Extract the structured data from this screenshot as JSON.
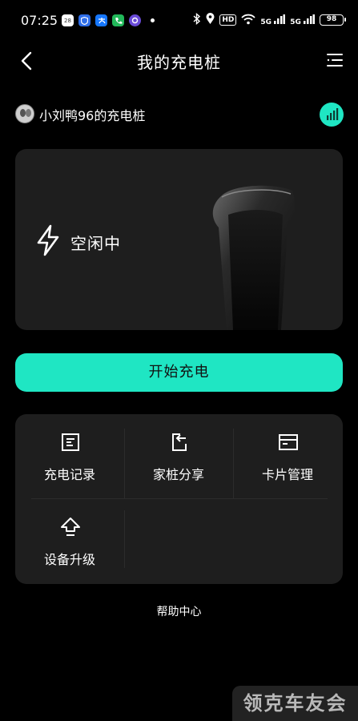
{
  "status_bar": {
    "time": "07:25",
    "calendar_day": "28",
    "hd_label": "HD",
    "sig1_label": "5G",
    "sig2_label": "5G",
    "battery": "98"
  },
  "header": {
    "title": "我的充电桩"
  },
  "owner": {
    "name": "小刘鸭96的充电桩"
  },
  "charger": {
    "status": "空闲中"
  },
  "actions": {
    "start_label": "开始充电"
  },
  "menu": {
    "items": [
      {
        "label": "充电记录",
        "icon": "document-icon"
      },
      {
        "label": "家桩分享",
        "icon": "share-icon"
      },
      {
        "label": "卡片管理",
        "icon": "card-icon"
      },
      {
        "label": "设备升级",
        "icon": "upgrade-icon"
      }
    ]
  },
  "footer": {
    "help_label": "帮助中心"
  },
  "watermark": {
    "text": "领克车友会"
  },
  "colors": {
    "accent": "#1fe6c3",
    "card_bg": "#1e1e1e",
    "page_bg": "#000000"
  }
}
